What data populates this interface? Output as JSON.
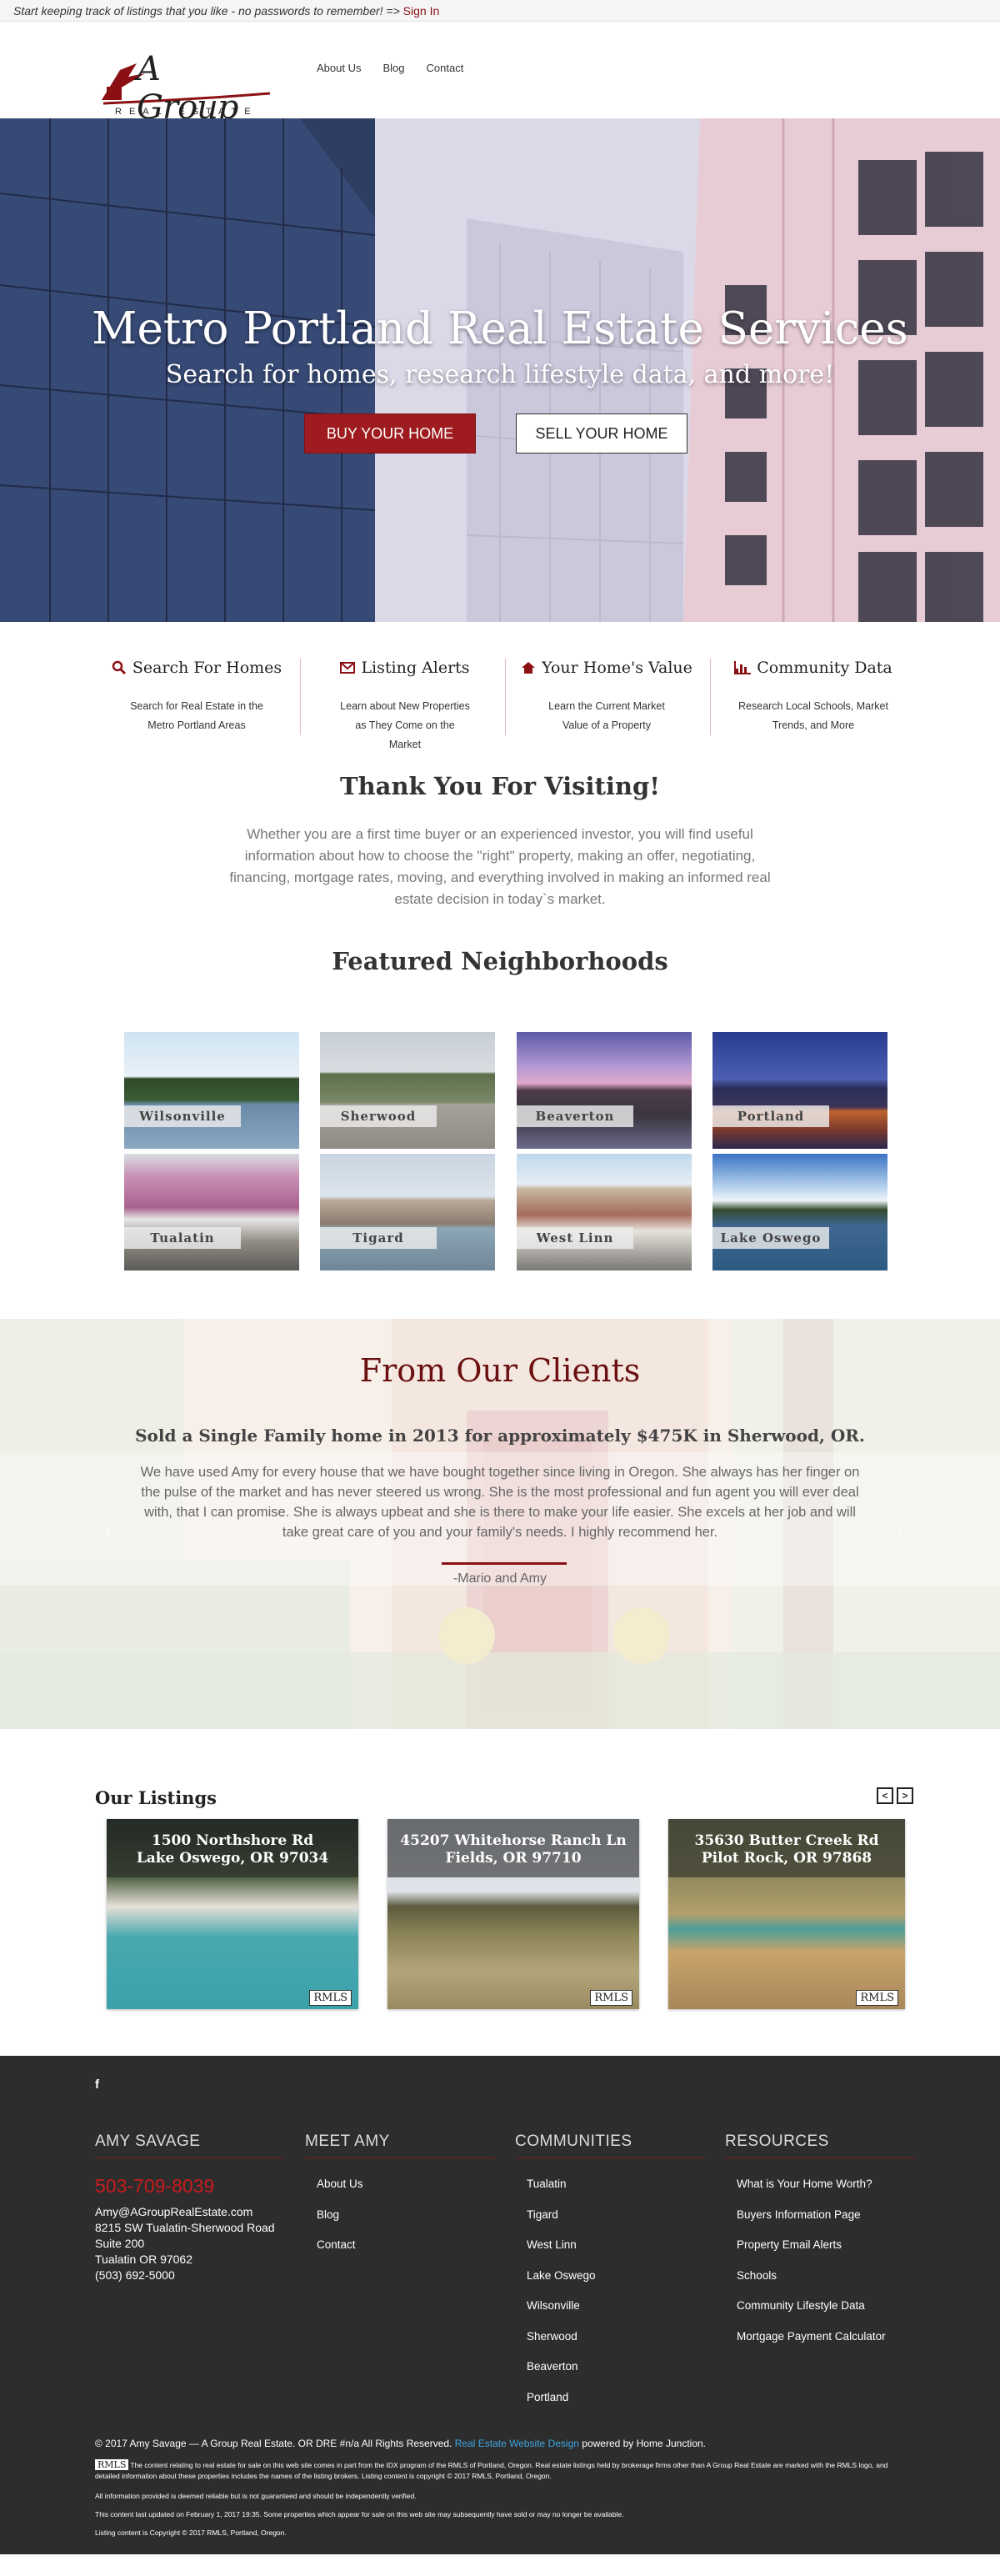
{
  "topbar": {
    "message": "Start keeping track of listings that you like - no passwords to remember! =>",
    "signin": "Sign In"
  },
  "logo": {
    "word": "A Group",
    "sub": "REAL ESTATE"
  },
  "nav": [
    "About Us",
    "Blog",
    "Contact"
  ],
  "hero": {
    "title": "Metro Portland Real Estate Services",
    "subtitle": "Search for homes, research lifestyle data, and more!",
    "buy": "BUY YOUR HOME",
    "sell": "SELL YOUR HOME"
  },
  "features": [
    {
      "icon": "search-icon",
      "title": "Search For Homes",
      "desc": "Search for Real Estate in the Metro Portland Areas"
    },
    {
      "icon": "envelope-icon",
      "title": "Listing Alerts",
      "desc": "Learn about New Properties as They Come on the Market"
    },
    {
      "icon": "home-icon",
      "title": "Your Home's Value",
      "desc": "Learn the Current Market Value of a Property"
    },
    {
      "icon": "bar-chart-icon",
      "title": "Community Data",
      "desc": "Research Local Schools, Market Trends, and More"
    }
  ],
  "thanks": {
    "title": "Thank You For Visiting!",
    "body": "Whether you are a first time buyer or an experienced investor, you will find useful information about how to choose the \"right\" property, making an offer, negotiating, financing, mortgage rates, moving, and everything involved in making an informed real estate decision in today`s market."
  },
  "featured": {
    "title": "Featured Neighborhoods",
    "items": [
      "Wilsonville",
      "Sherwood",
      "Beaverton",
      "Portland",
      "Tualatin",
      "Tigard",
      "West Linn",
      "Lake Oswego"
    ]
  },
  "clients": {
    "title": "From Our Clients",
    "headline": "Sold a Single Family home in 2013 for approximately $475K in Sherwood, OR.",
    "quote": "We have used Amy for every house that we have bought together since living in Oregon. She always has her finger on the pulse of the market and has never steered us wrong. She is the most professional and fun agent you will ever deal with, that I can promise. She is always upbeat and she is there to make your life easier. She excels at her job and will take great care of you and your family's needs. I highly recommend her.",
    "author": "-Mario and Amy"
  },
  "listings": {
    "title": "Our Listings",
    "items": [
      {
        "line1": "1500 Northshore Rd",
        "line2": "Lake Oswego, OR 97034",
        "badge": "RMLS"
      },
      {
        "line1": "45207 Whitehorse Ranch Ln",
        "line2": "Fields, OR 97710",
        "badge": "RMLS"
      },
      {
        "line1": "35630 Butter Creek Rd",
        "line2": "Pilot Rock, OR 97868",
        "badge": "RMLS"
      }
    ]
  },
  "footer": {
    "social": "f",
    "amy": {
      "heading": "AMY SAVAGE",
      "phone": "503-709-8039",
      "email": "Amy@AGroupRealEstate.com",
      "address1": "8215 SW Tualatin-Sherwood Road",
      "address2": "Suite 200",
      "address3": "Tualatin OR 97062",
      "phone2": "(503) 692-5000"
    },
    "meet": {
      "heading": "MEET AMY",
      "items": [
        "About Us",
        "Blog",
        "Contact"
      ]
    },
    "communities": {
      "heading": "COMMUNITIES",
      "items": [
        "Tualatin",
        "Tigard",
        "West Linn",
        "Lake Oswego",
        "Wilsonville",
        "Sherwood",
        "Beaverton",
        "Portland"
      ]
    },
    "resources": {
      "heading": "RESOURCES",
      "items": [
        "What is Your Home Worth?",
        "Buyers Information Page",
        "Property Email Alerts",
        "Schools",
        "Community Lifestyle Data",
        "Mortgage Payment Calculator"
      ]
    },
    "copyright_pre": "© 2017 Amy Savage — A Group Real Estate. OR DRE #n/a All Rights Reserved.",
    "copyright_link": "Real Estate Website Design",
    "copyright_post": "powered by Home Junction.",
    "rmls_badge": "RMLS",
    "disclaimer1": "The content relating to real estate for sale on this web site comes in part from the IDX program of the RMLS of Portland, Oregon. Real estate listings held by brokerage firms other than A Group Real Estate are marked with the RMLS logo, and detailed information about these properties includes the names of the listing brokers. Listing content is copyright © 2017 RMLS, Portland, Oregon.",
    "disclaimer2": "All information provided is deemed reliable but is not guaranteed and should be independently verified.",
    "disclaimer3": "This content last updated on February 1, 2017 19:35. Some properties which appear for sale on this web site may subsequently have sold or may no longer be available.",
    "disclaimer4": "Listing content is Copyright © 2017 RMLS, Portland, Oregon."
  }
}
